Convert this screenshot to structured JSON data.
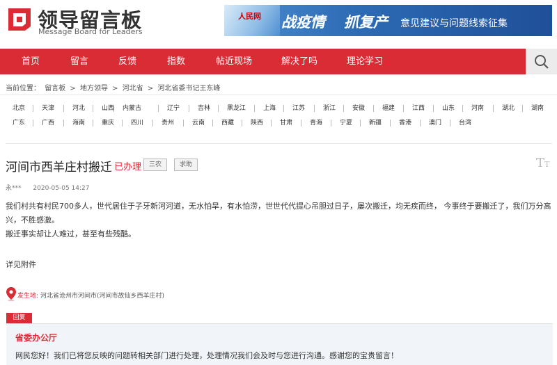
{
  "header": {
    "logo_title": "领导留言板",
    "logo_subtitle": "Message Board for Leaders",
    "banner": {
      "brand": "人民网",
      "headline1": "战疫情",
      "headline2": "抓复产",
      "tagline": "意见建议与问题线索征集"
    }
  },
  "nav": {
    "items": [
      "首页",
      "留言",
      "反馈",
      "指数",
      "帖近现场",
      "解决了吗",
      "理论学习"
    ],
    "search_icon": "search-icon",
    "accent": "#d92c34"
  },
  "breadcrumb": {
    "prefix": "当前位置：",
    "items": [
      "留言板",
      "地方领导",
      "河北省",
      "河北省委书记王东峰"
    ],
    "separator": ">"
  },
  "regions": {
    "row1": [
      "北京",
      "天津",
      "河北",
      "山西",
      "内蒙古",
      "辽宁",
      "吉林",
      "黑龙江",
      "上海",
      "江苏",
      "浙江",
      "安徽",
      "福建",
      "江西",
      "山东",
      "河南",
      "湖北",
      "湖南"
    ],
    "row2": [
      "广东",
      "广西",
      "海南",
      "重庆",
      "四川",
      "贵州",
      "云南",
      "西藏",
      "陕西",
      "甘肃",
      "青海",
      "宁夏",
      "新疆",
      "香港",
      "澳门",
      "台湾"
    ]
  },
  "message": {
    "title": "河间市西羊庄村搬迁",
    "status": "已办理",
    "tags": [
      "三农",
      "求助"
    ],
    "font_button": "T",
    "author": "永***",
    "datetime": "2020-05-05 14:27",
    "body_line1": "我们村共有村民700多人，世代居住于子牙新河河道，无水怕旱，有水怕涝，世世代代提心吊胆过日子，屡次搬迁，均无疾而终， 今事终于要搬迁了，我们万分高兴，不胜感激。",
    "body_line2": "搬迁事实却让人难过，甚至有些残酷。",
    "attachment": "详见附件",
    "location_label": "发生地:",
    "location": "河北省沧州市河间市(河间市故仙乡西羊庄村)"
  },
  "reply": {
    "tab_label": "回复",
    "org": "省委办公厅",
    "text": "网民您好！我们已将您反映的问题转相关部门进行处理，处理情况我们会及时与您进行沟通。感谢您的宝贵留言！"
  }
}
